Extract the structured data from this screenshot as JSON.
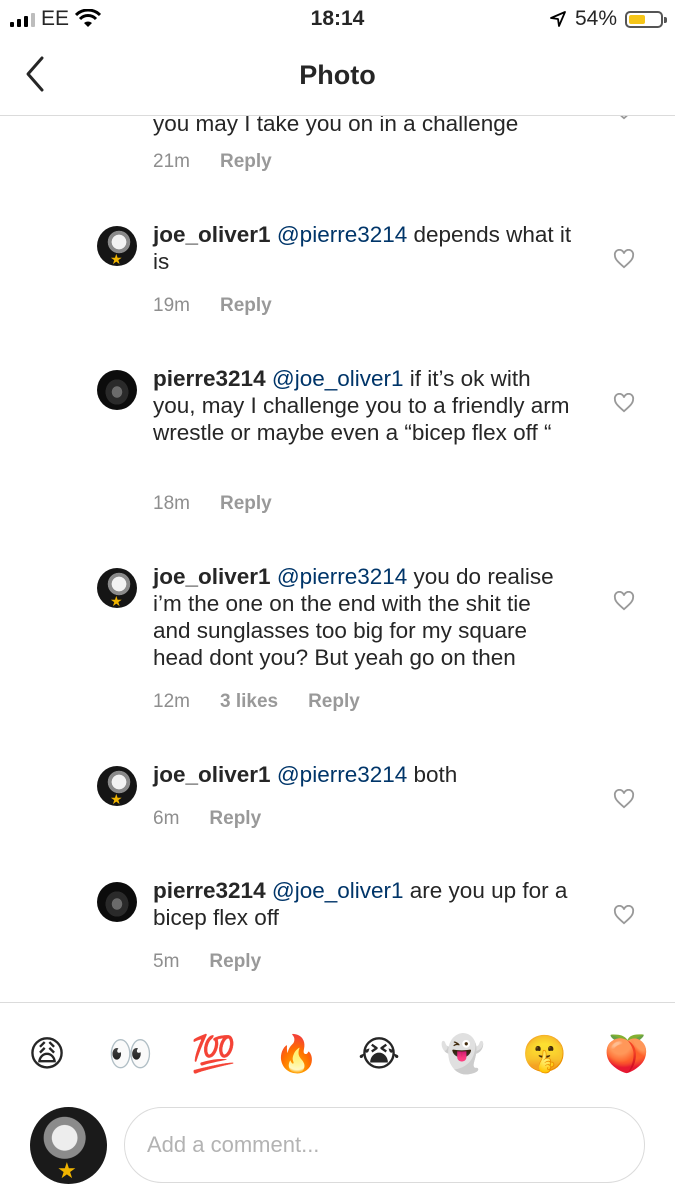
{
  "status_bar": {
    "carrier": "EE",
    "time": "18:14",
    "battery": "54%",
    "battery_level": 0.54
  },
  "header": {
    "title": "Photo"
  },
  "partial_comment": {
    "text": "you may I take you on in a challenge",
    "time": "21m",
    "reply": "Reply"
  },
  "comments": [
    {
      "username": "joe_oliver1",
      "mention": "@pierre3214",
      "text": " depends what it is",
      "time": "19m",
      "likes": "",
      "reply": "Reply"
    },
    {
      "username": "pierre3214",
      "mention": "@joe_oliver1",
      "text": " if it’s ok with you, may I challenge you to a friendly arm wrestle or maybe even a “bicep flex off “",
      "time": "18m",
      "likes": "",
      "reply": "Reply"
    },
    {
      "username": "joe_oliver1",
      "mention": "@pierre3214",
      "text": " you do realise i’m the one on the end with the shit tie and sunglasses too big for my square head dont you? But yeah go on then",
      "time": "12m",
      "likes": "3 likes",
      "reply": "Reply"
    },
    {
      "username": "joe_oliver1",
      "mention": "@pierre3214",
      "text": " both",
      "time": "6m",
      "likes": "",
      "reply": "Reply"
    },
    {
      "username": "pierre3214",
      "mention": "@joe_oliver1",
      "text": " are you up for a bicep flex off",
      "time": "5m",
      "likes": "",
      "reply": "Reply"
    }
  ],
  "emoji_bar": [
    {
      "name": "weary-face",
      "char": "😩"
    },
    {
      "name": "eyes",
      "char": "👀"
    },
    {
      "name": "hundred-points",
      "char": "💯"
    },
    {
      "name": "fire",
      "char": "🔥"
    },
    {
      "name": "crying-face",
      "char": "😭"
    },
    {
      "name": "ghost",
      "char": "👻"
    },
    {
      "name": "shushing-face",
      "char": "🤫"
    },
    {
      "name": "peach",
      "char": "🍑"
    }
  ],
  "composer": {
    "placeholder": "Add a comment..."
  },
  "colors": {
    "mention": "#003569",
    "muted": "#8e8e8e",
    "divider": "#dbdbdb",
    "battery": "#f5c518"
  }
}
